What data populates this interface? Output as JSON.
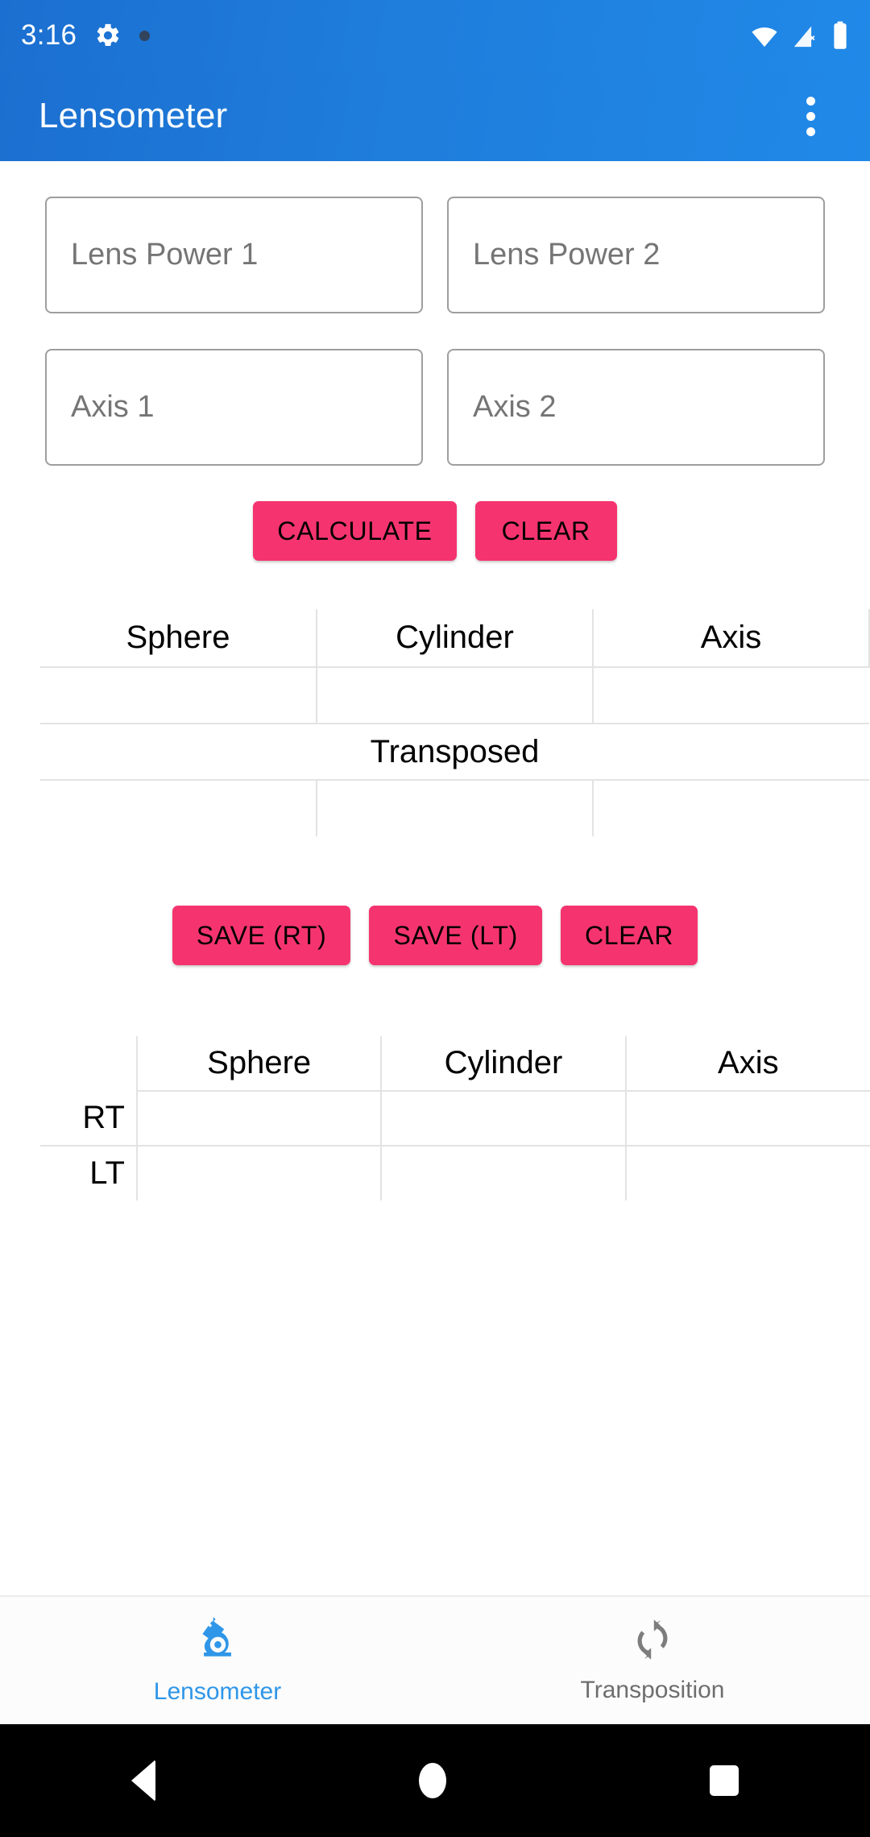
{
  "status_bar": {
    "time": "3:16",
    "icons": [
      "gear-icon",
      "dot-indicator-icon",
      "wifi-icon",
      "cellular-no-sim-icon",
      "battery-icon"
    ]
  },
  "app_bar": {
    "title": "Lensometer",
    "overflow_label": "More options"
  },
  "form": {
    "lens_power_1": {
      "placeholder": "Lens Power 1",
      "value": ""
    },
    "lens_power_2": {
      "placeholder": "Lens Power 2",
      "value": ""
    },
    "axis_1": {
      "placeholder": "Axis 1",
      "value": ""
    },
    "axis_2": {
      "placeholder": "Axis 2",
      "value": ""
    },
    "calculate_label": "CALCULATE",
    "clear_label": "CLEAR"
  },
  "result_table": {
    "headers": [
      "Sphere",
      "Cylinder",
      "Axis"
    ],
    "row_values": [
      "",
      "",
      ""
    ],
    "transposed_label": "Transposed",
    "transposed_values": [
      "",
      "",
      ""
    ]
  },
  "save_row": {
    "save_rt_label": "SAVE (RT)",
    "save_lt_label": "SAVE (LT)",
    "clear_label": "CLEAR"
  },
  "saved_table": {
    "corner": "",
    "headers": [
      "Sphere",
      "Cylinder",
      "Axis"
    ],
    "rows": [
      {
        "label": "RT",
        "values": [
          "",
          "",
          ""
        ]
      },
      {
        "label": "LT",
        "values": [
          "",
          "",
          ""
        ]
      }
    ]
  },
  "bottom_nav": {
    "items": [
      {
        "label": "Lensometer",
        "icon": "microscope-icon",
        "active": true
      },
      {
        "label": "Transposition",
        "icon": "swap-arrows-icon",
        "active": false
      }
    ]
  },
  "android_nav": {
    "back": "Back",
    "home": "Home",
    "recents": "Recents"
  },
  "colors": {
    "app_bar": "#1f7ddb",
    "accent_button": "#f5346f",
    "nav_active": "#2f96e8",
    "nav_inactive": "#6e6e6e",
    "field_border": "#9e9e9e"
  }
}
